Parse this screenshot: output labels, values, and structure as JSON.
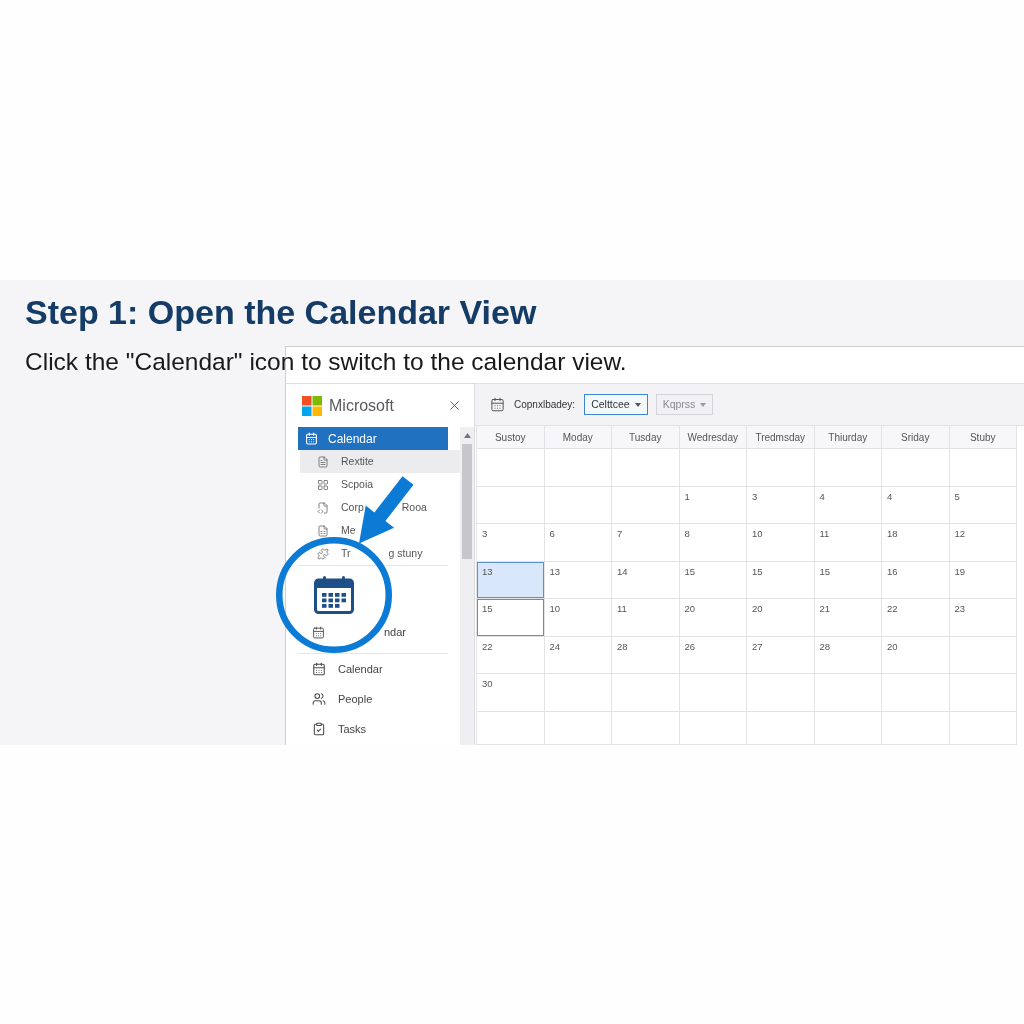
{
  "slide": {
    "title": "Step 1: Open the Calendar View",
    "instruction": "Click the \"Calendar\" icon to switch to the calendar view."
  },
  "window": {
    "sidebar": {
      "brand": "Microsoft",
      "nav": [
        {
          "label": "Calendar",
          "selected": true,
          "children": [
            {
              "label": "Rextite",
              "selected": true
            },
            {
              "label": "Scpoia",
              "selected": false
            },
            {
              "label": "Corp",
              "label_after": "Rooa",
              "selected": false
            },
            {
              "label": "Me",
              "selected": false
            },
            {
              "label": "Tr",
              "label_after": "g stuny",
              "selected": false
            }
          ]
        }
      ],
      "partial_item": {
        "label": "ndar"
      },
      "apps": [
        {
          "label": "Calendar",
          "selected": false
        },
        {
          "label": "People",
          "selected": false
        },
        {
          "label": "Tasks",
          "selected": false
        }
      ]
    },
    "toolbar": {
      "label": "Copnxlbadey:",
      "dropdowns": [
        {
          "value": "Celttcee",
          "focused": true
        },
        {
          "value": "Kqprss",
          "focused": false
        }
      ]
    },
    "calendar": {
      "weekdays": [
        "Sustoy",
        "Moday",
        "Tusday",
        "Wedresday",
        "Tredmsday",
        "Thiurday",
        "Sriday",
        "Stuby"
      ],
      "weeks": [
        [
          {
            "selected": false,
            "outlined": false
          },
          {
            "selected": false,
            "outlined": false
          },
          {
            "selected": false,
            "outlined": false
          },
          {
            "selected": false,
            "outlined": false
          },
          {
            "selected": false,
            "outlined": false
          },
          {
            "selected": false,
            "outlined": false
          },
          {
            "selected": false,
            "outlined": false
          },
          {
            "selected": false,
            "outlined": false
          }
        ],
        [
          {
            "selected": false,
            "outlined": false
          },
          {
            "selected": false,
            "outlined": false
          },
          {
            "selected": false,
            "outlined": false
          },
          {
            "day": "1",
            "selected": false,
            "outlined": false
          },
          {
            "day": "3",
            "selected": false,
            "outlined": false
          },
          {
            "day": "4",
            "selected": false,
            "outlined": false
          },
          {
            "day": "4",
            "selected": false,
            "outlined": false
          },
          {
            "day": "5",
            "selected": false,
            "outlined": false
          }
        ],
        [
          {
            "day": "3",
            "selected": false,
            "outlined": false
          },
          {
            "day": "6",
            "selected": false,
            "outlined": false
          },
          {
            "day": "7",
            "selected": false,
            "outlined": false
          },
          {
            "day": "8",
            "selected": false,
            "outlined": false
          },
          {
            "day": "10",
            "selected": false,
            "outlined": false
          },
          {
            "day": "11",
            "selected": false,
            "outlined": false
          },
          {
            "day": "18",
            "selected": false,
            "outlined": false
          },
          {
            "day": "12",
            "selected": false,
            "outlined": false
          }
        ],
        [
          {
            "day": "13",
            "selected": true,
            "outlined": true
          },
          {
            "day": "13",
            "selected": false,
            "outlined": false
          },
          {
            "day": "14",
            "selected": false,
            "outlined": false
          },
          {
            "day": "15",
            "selected": false,
            "outlined": false
          },
          {
            "day": "15",
            "selected": false,
            "outlined": false
          },
          {
            "day": "15",
            "selected": false,
            "outlined": false
          },
          {
            "day": "16",
            "selected": false,
            "outlined": false
          },
          {
            "day": "19",
            "selected": false,
            "outlined": false
          }
        ],
        [
          {
            "day": "15",
            "selected": false,
            "outlined": true
          },
          {
            "day": "10",
            "selected": false,
            "outlined": false
          },
          {
            "day": "11",
            "selected": false,
            "outlined": false
          },
          {
            "day": "20",
            "selected": false,
            "outlined": false
          },
          {
            "day": "20",
            "selected": false,
            "outlined": false
          },
          {
            "day": "21",
            "selected": false,
            "outlined": false
          },
          {
            "day": "22",
            "selected": false,
            "outlined": false
          },
          {
            "day": "23",
            "selected": false,
            "outlined": false
          }
        ],
        [
          {
            "day": "22",
            "selected": false,
            "outlined": false
          },
          {
            "day": "24",
            "selected": false,
            "outlined": false
          },
          {
            "day": "28",
            "selected": false,
            "outlined": false
          },
          {
            "day": "26",
            "selected": false,
            "outlined": false
          },
          {
            "day": "27",
            "selected": false,
            "outlined": false
          },
          {
            "day": "28",
            "selected": false,
            "outlined": false
          },
          {
            "day": "20",
            "selected": false,
            "outlined": false
          },
          {
            "selected": false,
            "outlined": false
          }
        ],
        [
          {
            "day": "30",
            "selected": false,
            "outlined": false
          },
          {
            "selected": false,
            "outlined": false
          },
          {
            "selected": false,
            "outlined": false
          },
          {
            "selected": false,
            "outlined": false
          },
          {
            "selected": false,
            "outlined": false
          },
          {
            "selected": false,
            "outlined": false
          },
          {
            "selected": false,
            "outlined": false
          },
          {
            "selected": false,
            "outlined": false
          }
        ],
        [
          {
            "selected": false,
            "outlined": false
          },
          {
            "selected": false,
            "outlined": false
          },
          {
            "selected": false,
            "outlined": false
          },
          {
            "selected": false,
            "outlined": false
          },
          {
            "selected": false,
            "outlined": false
          },
          {
            "selected": false,
            "outlined": false
          },
          {
            "selected": false,
            "outlined": false
          },
          {
            "selected": false,
            "outlined": false
          }
        ]
      ]
    }
  }
}
